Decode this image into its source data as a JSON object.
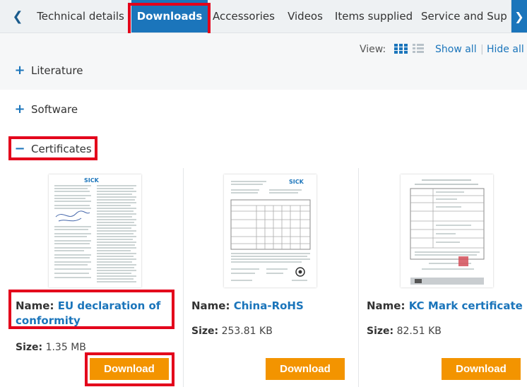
{
  "tabs": [
    {
      "label": "Technical details",
      "active": false
    },
    {
      "label": "Downloads",
      "active": true
    },
    {
      "label": "Accessories",
      "active": false
    },
    {
      "label": "Videos",
      "active": false
    },
    {
      "label": "Items supplied",
      "active": false
    },
    {
      "label": "Service and Sup",
      "active": false
    }
  ],
  "view": {
    "label": "View:",
    "grid_icon": "grid-icon",
    "list_icon": "list-icon",
    "show_all": "Show all",
    "separator": "|",
    "hide_all": "Hide all"
  },
  "sections": [
    {
      "sign": "+",
      "label": "Literature",
      "expanded": false
    },
    {
      "sign": "+",
      "label": "Software",
      "expanded": false
    },
    {
      "sign": "−",
      "label": "Certificates",
      "expanded": true
    }
  ],
  "documents": [
    {
      "name_label": "Name:",
      "name": "EU declaration of conformity",
      "size_label": "Size:",
      "size": "1.35 MB",
      "button": "Download"
    },
    {
      "name_label": "Name:",
      "name": "China-RoHS",
      "size_label": "Size:",
      "size": "253.81 KB",
      "button": "Download"
    },
    {
      "name_label": "Name:",
      "name": "KC Mark certificate",
      "size_label": "Size:",
      "size": "82.51 KB",
      "button": "Download"
    }
  ],
  "colors": {
    "accent": "#1b75bb",
    "button": "#f39400",
    "highlight": "#e3001b"
  }
}
